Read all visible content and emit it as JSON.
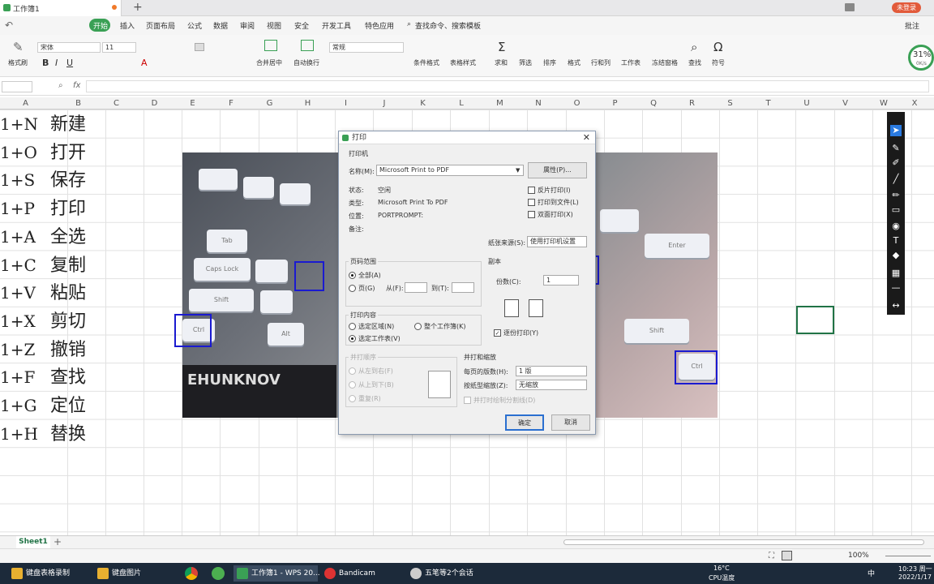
{
  "window": {
    "tab_title": "工作簿1",
    "badge": "未登录"
  },
  "menu": {
    "items": [
      "开始",
      "插入",
      "页面布局",
      "公式",
      "数据",
      "审阅",
      "视图",
      "安全",
      "开发工具",
      "特色应用"
    ],
    "search": "查找命令、搜索模板",
    "annotate": "批注"
  },
  "ribbon": {
    "font_name": "宋体",
    "font_size": "11",
    "number_format": "常规",
    "labels": {
      "format_painter": "格式刷",
      "merge_center": "合并居中",
      "wrap": "自动换行",
      "cond_format": "条件格式",
      "table_style": "表格样式",
      "sum": "求和",
      "filter": "筛选",
      "sort": "排序",
      "format": "格式",
      "rowcol": "行和列",
      "worksheet": "工作表",
      "freeze": "冻结窗格",
      "find": "查找",
      "symbol": "符号"
    },
    "perf": {
      "cpu": "31%",
      "net": "0K/s"
    }
  },
  "formula": {
    "fx": "fx"
  },
  "columns": [
    "A",
    "B",
    "C",
    "D",
    "E",
    "F",
    "G",
    "H",
    "I",
    "J",
    "K",
    "L",
    "M",
    "N",
    "O",
    "P",
    "Q",
    "R",
    "S",
    "T",
    "U",
    "V",
    "W",
    "X"
  ],
  "rows": [
    {
      "a": "1+N",
      "b": "新建"
    },
    {
      "a": "1+O",
      "b": "打开"
    },
    {
      "a": "1+S",
      "b": "保存"
    },
    {
      "a": "1+P",
      "b": "打印"
    },
    {
      "a": "1+A",
      "b": "全选"
    },
    {
      "a": "1+C",
      "b": "复制"
    },
    {
      "a": "1+V",
      "b": "粘贴"
    },
    {
      "a": "1+X",
      "b": "剪切"
    },
    {
      "a": "1+Z",
      "b": "撤销"
    },
    {
      "a": "1+F",
      "b": "查找"
    },
    {
      "a": "1+G",
      "b": "定位"
    },
    {
      "a": "1+H",
      "b": "替换"
    }
  ],
  "photo": {
    "keys": [
      "Ctrl",
      "Shift",
      "Alt",
      "Caps Lock",
      "Tab",
      "Ctrl",
      "Shift",
      "Enter"
    ],
    "banner": "EHUNKNOV"
  },
  "dialog": {
    "title": "打印",
    "printer_section": "打印机",
    "name_label": "名称(M):",
    "printer_name": "Microsoft Print to PDF",
    "properties_button": "属性(P)...",
    "status_label": "状态:",
    "status_value": "空闲",
    "type_label": "类型:",
    "type_value": "Microsoft Print To PDF",
    "where_label": "位置:",
    "where_value": "PORTPROMPT:",
    "comment_label": "备注:",
    "reverse_print": "反片打印(I)",
    "print_to_file": "打印到文件(L)",
    "duplex": "双面打印(X)",
    "paper_source_label": "纸张来源(S):",
    "paper_source_value": "使用打印机设置",
    "range_section": "页码范围",
    "range_all": "全部(A)",
    "range_pages": "页(G)",
    "from_label": "从(F):",
    "to_label": "到(T):",
    "copies_section": "副本",
    "copies_label": "份数(C):",
    "copies_value": "1",
    "content_section": "打印内容",
    "content_selection": "选定区域(N)",
    "content_workbook": "整个工作簿(K)",
    "content_sheet": "选定工作表(V)",
    "collate": "逐份打印(Y)",
    "order_section": "并打顺序",
    "order_lr": "从左到右(F)",
    "order_tb": "从上到下(B)",
    "order_repeat": "重复(R)",
    "scale_section": "并打和缩放",
    "pages_per_sheet_label": "每页的版数(H):",
    "pages_per_sheet_value": "1 版",
    "scale_label": "按纸型缩放(Z):",
    "scale_value": "无缩放",
    "draw_borders": "并打时绘制分割线(D)",
    "ok": "确定",
    "cancel": "取消"
  },
  "sheet": {
    "tab": "Sheet1"
  },
  "status": {
    "zoom": "100%"
  },
  "taskbar": {
    "items": [
      "键盘表格录制",
      "键盘图片",
      "工作簿1 - WPS 20...",
      "Bandicam",
      "五笔等2个会话"
    ],
    "weather": "16°C",
    "cpu": "CPU温度",
    "time": "10:23 周一",
    "date": "2022/1/17",
    "lang": "中"
  }
}
